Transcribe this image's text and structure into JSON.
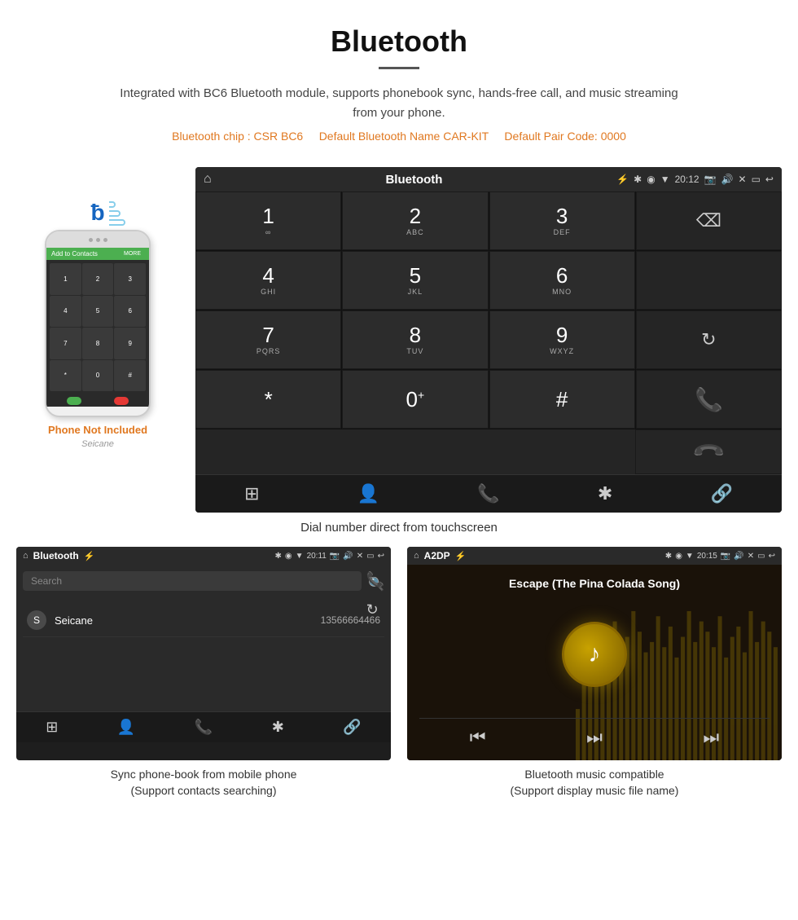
{
  "page": {
    "title": "Bluetooth",
    "divider": true,
    "description": "Integrated with BC6 Bluetooth module, supports phonebook sync, hands-free call, and music streaming from your phone.",
    "specs": "(Bluetooth chip : CSR BC6    Default Bluetooth Name CAR-KIT    Default Pair Code: 0000)",
    "specs_chip": "Bluetooth chip : CSR BC6",
    "specs_name": "Default Bluetooth Name CAR-KIT",
    "specs_pair": "Default Pair Code: 0000"
  },
  "phone_label": "Phone Not Included",
  "main_screen": {
    "statusbar": {
      "home": "⌂",
      "title": "Bluetooth",
      "usb": "⚡",
      "time": "20:12",
      "bluetooth": "✱",
      "gps": "◉",
      "signal": "▼",
      "camera": "📷",
      "volume": "🔊",
      "close": "✕",
      "window": "▭",
      "back": "↩"
    },
    "dialer": {
      "keys": [
        {
          "num": "1",
          "sub": "∞",
          "type": "key"
        },
        {
          "num": "2",
          "sub": "ABC",
          "type": "key"
        },
        {
          "num": "3",
          "sub": "DEF",
          "type": "key"
        },
        {
          "num": "",
          "sub": "",
          "type": "backspace"
        },
        {
          "num": "4",
          "sub": "GHI",
          "type": "key"
        },
        {
          "num": "5",
          "sub": "JKL",
          "type": "key"
        },
        {
          "num": "6",
          "sub": "MNO",
          "type": "key"
        },
        {
          "num": "",
          "sub": "",
          "type": "empty"
        },
        {
          "num": "7",
          "sub": "PQRS",
          "type": "key"
        },
        {
          "num": "8",
          "sub": "TUV",
          "type": "key"
        },
        {
          "num": "9",
          "sub": "WXYZ",
          "type": "key"
        },
        {
          "num": "",
          "sub": "",
          "type": "refresh"
        },
        {
          "num": "*",
          "sub": "",
          "type": "key"
        },
        {
          "num": "0",
          "sub": "+",
          "type": "key"
        },
        {
          "num": "#",
          "sub": "",
          "type": "key"
        },
        {
          "num": "",
          "sub": "",
          "type": "call-green"
        },
        {
          "num": "",
          "sub": "",
          "type": "call-red"
        }
      ]
    },
    "toolbar": {
      "icons": [
        "⊞",
        "👤",
        "📞",
        "✱",
        "🔗"
      ]
    }
  },
  "main_caption": "Dial number direct from touchscreen",
  "phonebook_screen": {
    "statusbar": {
      "home": "⌂",
      "title": "Bluetooth",
      "usb": "⚡",
      "time": "20:11",
      "bluetooth": "✱",
      "gps": "◉",
      "signal": "▼"
    },
    "search_placeholder": "Search",
    "contacts": [
      {
        "initial": "S",
        "name": "Seicane",
        "number": "13566664466"
      }
    ],
    "toolbar_icons": [
      "⊞",
      "👤",
      "📞",
      "✱",
      "🔗"
    ]
  },
  "phonebook_caption": "Sync phone-book from mobile phone\n(Support contacts searching)",
  "music_screen": {
    "statusbar": {
      "home": "⌂",
      "title": "A2DP",
      "usb": "⚡",
      "time": "20:15",
      "bluetooth": "✱",
      "gps": "◉",
      "signal": "▼"
    },
    "song_title": "Escape (The Pina Colada Song)",
    "controls": [
      "⏮",
      "⏭",
      "⏭"
    ]
  },
  "music_caption": "Bluetooth music compatible\n(Support display music file name)",
  "waveform_heights": [
    20,
    35,
    50,
    30,
    60,
    45,
    55,
    30,
    40,
    65,
    50,
    35,
    45,
    60,
    40,
    55,
    30,
    50,
    65,
    35,
    45,
    55,
    40,
    60,
    30,
    50,
    45,
    35,
    55,
    65,
    40,
    30,
    50,
    45,
    60,
    35,
    55,
    30,
    65,
    45,
    40,
    50,
    35,
    60,
    30,
    55,
    45,
    65,
    40,
    50
  ]
}
